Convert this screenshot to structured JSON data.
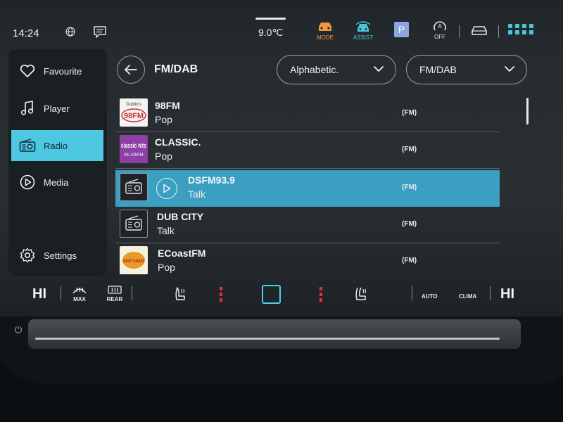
{
  "status": {
    "time": "14:24",
    "temperature": "9.0℃",
    "mode_label": "MODE",
    "assist_label": "ASSIST",
    "park_label": "P",
    "auto_off_label": "OFF",
    "colors": {
      "mode": "#f09a3c",
      "assist": "#49c6dc",
      "park": "#8aa7de"
    },
    "icons": [
      "globe-icon",
      "message-icon",
      "mode-icon",
      "assist-icon",
      "parking-icon",
      "auto-off-icon",
      "car-icon",
      "apps-grid-icon"
    ]
  },
  "sidebar": {
    "items": [
      {
        "label": "Favourite",
        "icon": "heart-icon",
        "active": false
      },
      {
        "label": "Player",
        "icon": "music-note-icon",
        "active": false
      },
      {
        "label": "Radio",
        "icon": "radio-icon",
        "active": true
      },
      {
        "label": "Media",
        "icon": "play-circle-icon",
        "active": false
      },
      {
        "label": "Settings",
        "icon": "gear-icon",
        "active": false
      }
    ],
    "accent": "#4ec7e0"
  },
  "header": {
    "title": "FM/DAB",
    "sort_dropdown": "Alphabetic.",
    "source_dropdown": "FM/DAB"
  },
  "stations": [
    {
      "name": "98FM",
      "genre": "Pop",
      "band": "(FM)",
      "logo_text": "98FM",
      "logo_subtext": "Dublin's",
      "active": false
    },
    {
      "name": "CLASSIC.",
      "genre": "Pop",
      "band": "(FM)",
      "logo_text": "classic hits",
      "logo_subtext": "94-105FM",
      "active": false
    },
    {
      "name": "DSFM93.9",
      "genre": "Talk",
      "band": "(FM)",
      "logo_text": "",
      "active": true
    },
    {
      "name": "DUB CITY",
      "genre": "Talk",
      "band": "(FM)",
      "logo_text": "",
      "active": false
    },
    {
      "name": "ECoastFM",
      "genre": "Pop",
      "band": "(FM)",
      "logo_text": "east coast",
      "active": false
    }
  ],
  "climate": {
    "left_temp": "HI",
    "right_temp": "HI",
    "max_label": "MAX",
    "rear_label": "REAR",
    "auto_label": "AUTO",
    "clima_label": "CLIMA",
    "colors": {
      "heat": "#e0323c",
      "home": "#49d3e6"
    }
  }
}
